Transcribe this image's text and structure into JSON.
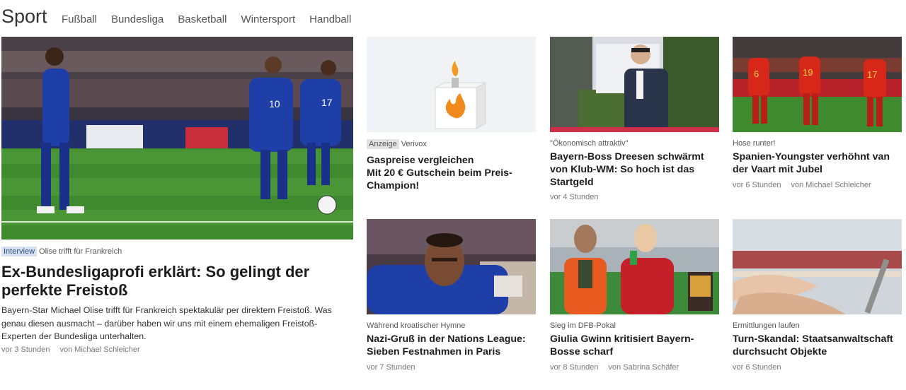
{
  "header": {
    "title": "Sport",
    "links": [
      "Fußball",
      "Bundesliga",
      "Basketball",
      "Wintersport",
      "Handball"
    ]
  },
  "main": {
    "badge": "Interview",
    "kicker": "Olise trifft für Frankreich",
    "headline_1": "Ex-Bundesligaprofi erklärt: So gelingt der",
    "headline_2": "perfekte Freistoß",
    "teaser_1": "Bayern-Star Michael Olise trifft für Frankreich spektakulär per direktem Freistoß. Was",
    "teaser_2": "genau diesen ausmacht – darüber haben wir uns mit einem ehemaligen Freistoß-",
    "teaser_3": "Experten der Bundesliga unterhalten.",
    "time": "vor 3 Stunden",
    "author": "von Michael Schleicher"
  },
  "cards": [
    {
      "badge": "Anzeige",
      "kicker": "Verivox",
      "headline": [
        "Gaspreise vergleichen",
        "Mit 20 € Gutschein beim Preis-",
        "Champion!"
      ],
      "time": "",
      "author": ""
    },
    {
      "kicker": "\"Ökonomisch attraktiv\"",
      "headline": [
        "Bayern-Boss Dreesen schwärmt",
        "von Klub-WM: So hoch ist das",
        "Startgeld"
      ],
      "time": "vor 4 Stunden",
      "author": ""
    },
    {
      "kicker": "Hose runter!",
      "headline": [
        "Spanien-Youngster verhöhnt van",
        "der Vaart mit Jubel"
      ],
      "time": "vor 6 Stunden",
      "author": "von Michael Schleicher"
    },
    {
      "kicker": "Während kroatischer Hymne",
      "headline": [
        "Nazi-Gruß in der Nations League:",
        "Sieben Festnahmen in Paris"
      ],
      "time": "vor 7 Stunden",
      "author": ""
    },
    {
      "kicker": "Sieg im DFB-Pokal",
      "headline": [
        "Giulia Gwinn kritisiert Bayern-",
        "Bosse scharf"
      ],
      "time": "vor 8 Stunden",
      "author": "von Sabrina Schäfer"
    },
    {
      "kicker": "Ermittlungen laufen",
      "headline": [
        "Turn-Skandal: Staatsanwaltschaft",
        "durchsucht Objekte"
      ],
      "time": "vor 6 Stunden",
      "author": ""
    }
  ],
  "photo_numbers": {
    "france_a": "10",
    "france_b": "17",
    "spain_a": "6",
    "spain_b": "19",
    "spain_c": "17"
  },
  "colors": {
    "france_blue": "#1f3fa8",
    "spain_red": "#d62718",
    "pitch_green": "#3f8a2f",
    "flame_orange": "#f08a1c"
  }
}
